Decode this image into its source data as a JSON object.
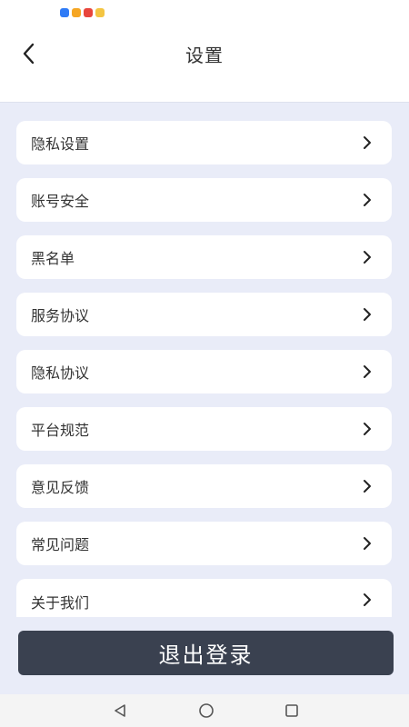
{
  "status_bar": {
    "icons": [
      {
        "name": "app-icon-1",
        "color": "#2f7bf6"
      },
      {
        "name": "app-icon-2",
        "color": "#f5a623"
      },
      {
        "name": "app-icon-3",
        "color": "#e8453c"
      },
      {
        "name": "app-icon-4",
        "color": "#f4c542"
      }
    ]
  },
  "header": {
    "title": "设置",
    "back_icon": "chevron-left-icon"
  },
  "menu": {
    "items": [
      {
        "label": "隐私设置"
      },
      {
        "label": "账号安全"
      },
      {
        "label": "黑名单"
      },
      {
        "label": "服务协议"
      },
      {
        "label": "隐私协议"
      },
      {
        "label": "平台规范"
      },
      {
        "label": "意见反馈"
      },
      {
        "label": "常见问题"
      },
      {
        "label": "关于我们"
      }
    ]
  },
  "logout": {
    "label": "退出登录"
  },
  "colors": {
    "content_bg": "#e9ecf8",
    "logout_bg": "#3a4150",
    "card_bg": "#ffffff"
  },
  "nav": {
    "back": "triangle-back-icon",
    "home": "circle-home-icon",
    "recents": "square-recents-icon"
  }
}
